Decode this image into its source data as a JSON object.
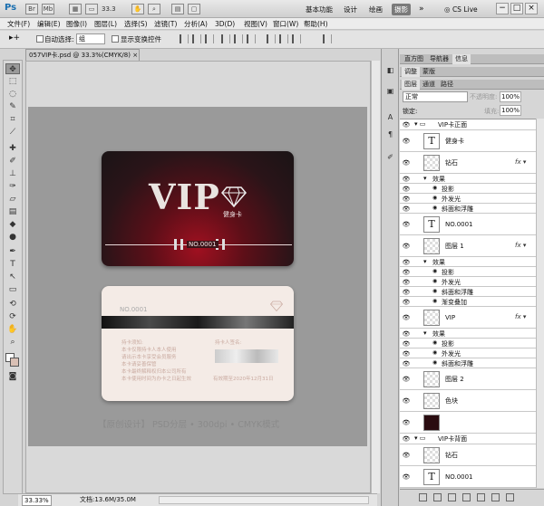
{
  "app": {
    "logo": "Ps",
    "zoom": "33.3"
  },
  "workspaces": [
    "基本功能",
    "设计",
    "绘画",
    "摄影"
  ],
  "cs_live": "CS Live",
  "window_buttons": [
    "−",
    "□",
    "×"
  ],
  "menus": [
    "文件(F)",
    "编辑(E)",
    "图像(I)",
    "图层(L)",
    "选择(S)",
    "滤镜(T)",
    "分析(A)",
    "3D(D)",
    "视图(V)",
    "窗口(W)",
    "帮助(H)"
  ],
  "options": {
    "move_tool": "▸+",
    "auto_select": "自动选择:",
    "auto_select_value": "组",
    "show_transform": "显示变换控件"
  },
  "doc_tab": "057VIP卡.psd @ 33.3%(CMYK/8)",
  "card_front": {
    "title": "VIP",
    "subtitle": "健身卡",
    "number": "NO.0001"
  },
  "card_back": {
    "number": "NO.0001",
    "notes": [
      "持卡须知:",
      "本卡仅限持卡人本人使用",
      "请出示本卡享受会员服务",
      "本卡请妥善保管",
      "本卡最终解释权归本公司所有",
      "本卡使用时间为办卡之日起生效"
    ],
    "sign_label": "持卡人签名:",
    "footer": "有效期至2020年12月31日"
  },
  "caption": "【原创设计】    PSD分层 • 300dpi • CMYK模式",
  "status": {
    "zoom": "33.33%",
    "doc": "文档:13.6M/35.0M"
  },
  "panel_tabs": {
    "row1": [
      "直方图",
      "导航器",
      "信息"
    ],
    "row2": [
      "调整",
      "蒙版"
    ],
    "row3": [
      "图层",
      "通道",
      "路径"
    ]
  },
  "layers_panel": {
    "blend": "正常",
    "opacity_label": "不透明度:",
    "opacity": "100%",
    "lock_label": "锁定:",
    "fill_label": "填充:",
    "fill": "100%"
  },
  "layers": [
    {
      "type": "group",
      "name": "VIP卡正面",
      "indent": 0
    },
    {
      "type": "text",
      "name": "健身卡",
      "indent": 1
    },
    {
      "type": "image",
      "name": "钻石",
      "indent": 1,
      "fx": true
    },
    {
      "type": "effects-label",
      "name": "效果",
      "indent": 2
    },
    {
      "type": "effect",
      "name": "投影",
      "indent": 3
    },
    {
      "type": "effect",
      "name": "外发光",
      "indent": 3
    },
    {
      "type": "effect",
      "name": "斜面和浮雕",
      "indent": 3
    },
    {
      "type": "text",
      "name": "NO.0001",
      "indent": 1
    },
    {
      "type": "image",
      "name": "图层 1",
      "indent": 1,
      "fx": true
    },
    {
      "type": "effects-label",
      "name": "效果",
      "indent": 2
    },
    {
      "type": "effect",
      "name": "投影",
      "indent": 3
    },
    {
      "type": "effect",
      "name": "外发光",
      "indent": 3
    },
    {
      "type": "effect",
      "name": "斜面和浮雕",
      "indent": 3
    },
    {
      "type": "effect",
      "name": "渐变叠加",
      "indent": 3
    },
    {
      "type": "image",
      "name": "VIP",
      "indent": 1,
      "fx": true
    },
    {
      "type": "effects-label",
      "name": "效果",
      "indent": 2
    },
    {
      "type": "effect",
      "name": "投影",
      "indent": 3
    },
    {
      "type": "effect",
      "name": "外发光",
      "indent": 3
    },
    {
      "type": "effect",
      "name": "斜面和浮雕",
      "indent": 3
    },
    {
      "type": "image",
      "name": "图层 2",
      "indent": 1
    },
    {
      "type": "image",
      "name": "色块",
      "indent": 1
    },
    {
      "type": "image",
      "name": "",
      "indent": 1,
      "dark": true
    },
    {
      "type": "group",
      "name": "VIP卡背面",
      "indent": 0
    },
    {
      "type": "image",
      "name": "钻石",
      "indent": 1
    },
    {
      "type": "text",
      "name": "NO.0001",
      "indent": 1
    }
  ],
  "tools": [
    "move",
    "marquee",
    "lasso",
    "quick-select",
    "crop",
    "eyedropper",
    "healing",
    "brush",
    "stamp",
    "history",
    "eraser",
    "gradient",
    "blur",
    "dodge",
    "pen",
    "type",
    "path-select",
    "shape",
    "3d-rotate",
    "3d-orbit",
    "hand",
    "zoom"
  ],
  "colors": {
    "accent": "#7a7a7a",
    "card_red": "#a01020",
    "card_back": "#f4ebe6"
  }
}
